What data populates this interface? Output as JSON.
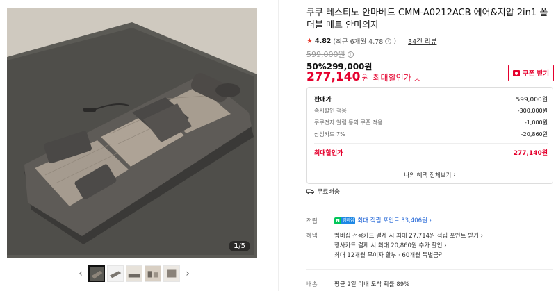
{
  "gallery": {
    "page_current": "1",
    "page_total": "/5",
    "prev_icon": "chevron-left-icon",
    "next_icon": "chevron-right-icon",
    "prev": "‹",
    "next": "›"
  },
  "product": {
    "title": "쿠쿠 레스티노 안마베드 CMM-A0212ACB 에어&지압 2in1 폴더블 매트 안마의자",
    "rating": "4.82",
    "rating_recent": "(최근 6개월 4.78",
    "rating_recent_close": ")",
    "reviews": "34건 리뷰",
    "original_price": "599,000원",
    "discount_rate": "50%",
    "sale_price": "299,000원",
    "best_price": "277,140",
    "best_won": "원",
    "best_label": "최대할인가",
    "coupon_button": "쿠폰 받기"
  },
  "price_breakdown": {
    "head_label": "판매가",
    "head_value": "599,000원",
    "rows": [
      {
        "label": "즉시할인 적용",
        "value": "-300,000원"
      },
      {
        "label": "쿠쿠전자 알림 등의 쿠폰 적용",
        "value": "-1,000원"
      },
      {
        "label": "삼성카드 7%",
        "value": "-20,860원"
      }
    ],
    "final_label": "최대할인가",
    "final_value": "277,140원",
    "benefit_link": "나의 혜택 전체보기"
  },
  "shipping": {
    "label": "무료배송"
  },
  "specs": {
    "point_label": "적립",
    "npay_n": "N",
    "npay_p": "멤버십",
    "point_value": "최대 적립 포인트 33,406원",
    "benefit_label": "혜택",
    "benefits": [
      "멤버십 전용카드 결제 시 최대 27,714원 적립 포인트 받기",
      "행사카드 결제 시 최대 20,860원 추가 할인",
      "최대 12개월 무이자 할부 · 60개월 특별금리"
    ],
    "delivery_label": "배송",
    "delivery_value": "평균 2일 이내 도착 확률 89%"
  },
  "colors": {
    "accent_red": "#e5002d",
    "npay_green": "#03c75a",
    "point_blue": "#1e63d6"
  }
}
